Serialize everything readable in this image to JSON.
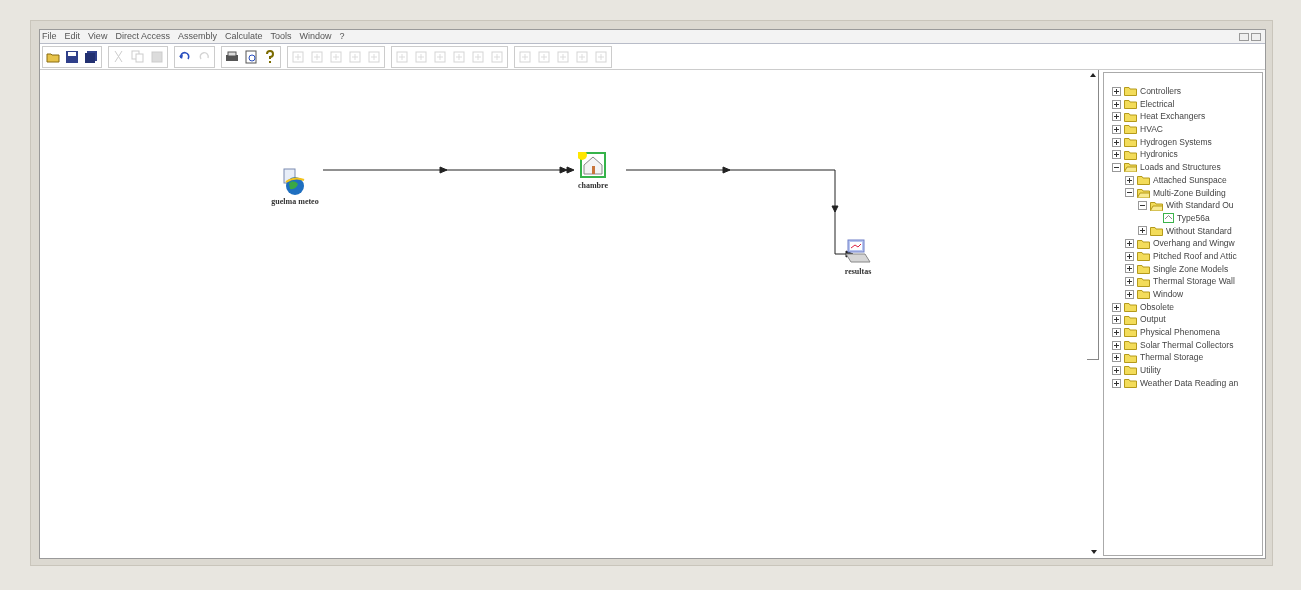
{
  "menu": [
    "File",
    "Edit",
    "View",
    "Direct Access",
    "Assembly",
    "Calculate",
    "Tools",
    "Window",
    "?"
  ],
  "toolbar": [
    [
      {
        "kind": "open",
        "disabled": false
      },
      {
        "kind": "save",
        "disabled": false
      },
      {
        "kind": "save-all",
        "disabled": false
      }
    ],
    [
      {
        "kind": "cut",
        "disabled": true
      },
      {
        "kind": "copy",
        "disabled": true
      },
      {
        "kind": "paste",
        "disabled": true
      }
    ],
    [
      {
        "kind": "undo",
        "disabled": false
      },
      {
        "kind": "redo",
        "disabled": true
      }
    ],
    [
      {
        "kind": "print",
        "disabled": false
      },
      {
        "kind": "preview",
        "disabled": false
      },
      {
        "kind": "help",
        "disabled": false
      }
    ],
    [
      {
        "kind": "tool",
        "disabled": true
      },
      {
        "kind": "tool",
        "disabled": true
      },
      {
        "kind": "tool",
        "disabled": true
      },
      {
        "kind": "tool",
        "disabled": true
      },
      {
        "kind": "tool",
        "disabled": true
      }
    ],
    [
      {
        "kind": "tool",
        "disabled": true
      },
      {
        "kind": "tool",
        "disabled": true
      },
      {
        "kind": "tool",
        "disabled": true
      },
      {
        "kind": "tool",
        "disabled": true
      },
      {
        "kind": "tool",
        "disabled": true
      },
      {
        "kind": "tool",
        "disabled": true
      }
    ],
    [
      {
        "kind": "tool",
        "disabled": true
      },
      {
        "kind": "tool",
        "disabled": true
      },
      {
        "kind": "tool",
        "disabled": true
      },
      {
        "kind": "tool",
        "disabled": true
      },
      {
        "kind": "tool",
        "disabled": true
      }
    ]
  ],
  "canvas": {
    "components": [
      {
        "kind": "weather",
        "label": "guelma meteo"
      },
      {
        "kind": "building",
        "label": "chambre"
      },
      {
        "kind": "printer",
        "label": "resultas"
      }
    ]
  },
  "tree": [
    {
      "label": "Controllers",
      "expanded": false
    },
    {
      "label": "Electrical",
      "expanded": false
    },
    {
      "label": "Heat Exchangers",
      "expanded": false
    },
    {
      "label": "HVAC",
      "expanded": false
    },
    {
      "label": "Hydrogen Systems",
      "expanded": false
    },
    {
      "label": "Hydronics",
      "expanded": false
    },
    {
      "label": "Loads and Structures",
      "expanded": true,
      "children": [
        {
          "label": "Attached Sunspace",
          "expanded": false
        },
        {
          "label": "Multi-Zone Building",
          "expanded": true,
          "children": [
            {
              "label": "With Standard Ou",
              "expanded": true,
              "children": [
                {
                  "label": "Type56a",
                  "kind": "component"
                }
              ]
            },
            {
              "label": "Without Standard",
              "expanded": false
            }
          ]
        },
        {
          "label": "Overhang and Wingw",
          "expanded": false
        },
        {
          "label": "Pitched Roof and Attic",
          "expanded": false
        },
        {
          "label": "Single Zone Models",
          "expanded": false
        },
        {
          "label": "Thermal Storage Wall",
          "expanded": false
        },
        {
          "label": "Window",
          "expanded": false
        }
      ]
    },
    {
      "label": "Obsolete",
      "expanded": false
    },
    {
      "label": "Output",
      "expanded": false
    },
    {
      "label": "Physical Phenomena",
      "expanded": false
    },
    {
      "label": "Solar Thermal Collectors",
      "expanded": false
    },
    {
      "label": "Thermal Storage",
      "expanded": false
    },
    {
      "label": "Utility",
      "expanded": false
    },
    {
      "label": "Weather Data Reading an",
      "expanded": false
    }
  ]
}
